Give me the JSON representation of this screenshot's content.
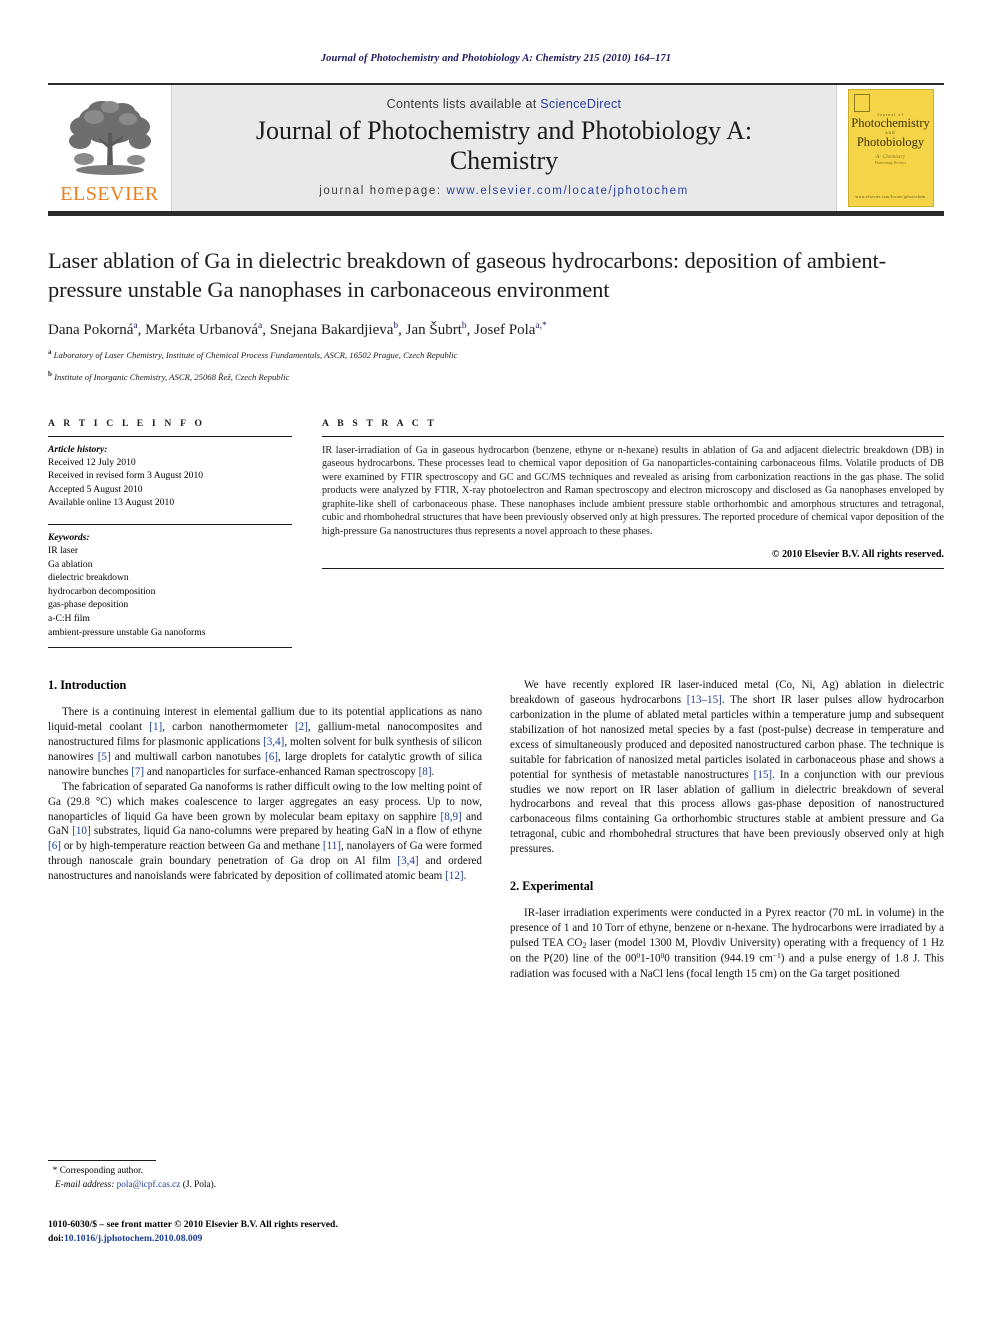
{
  "running_head": "Journal of Photochemistry and Photobiology A: Chemistry 215 (2010) 164–171",
  "masthead": {
    "publisher_logo_text": "ELSEVIER",
    "contents_prefix": "Contents lists available at ",
    "contents_link": "ScienceDirect",
    "journal_title_line1": "Journal of Photochemistry and Photobiology A:",
    "journal_title_line2": "Chemistry",
    "homepage_prefix": "journal homepage: ",
    "homepage_url": "www.elsevier.com/locate/jphotochem",
    "cover": {
      "kicker": "Journal of",
      "line1": "Photochemistry",
      "and": "and",
      "line2": "Photobiology",
      "sub": "A: Chemistry",
      "sub2": "Photoenergy Reviews",
      "footer": "www.elsevier.com/locate/jphotochem"
    }
  },
  "article": {
    "title": "Laser ablation of Ga in dielectric breakdown of gaseous hydrocarbons: deposition of ambient-pressure unstable Ga nanophases in carbonaceous environment",
    "authors_html": "Dana Pokorná<sup>a</sup>, Markéta Urbanová<sup>a</sup>, Snejana Bakardjieva<sup>b</sup>, Jan Šubrt<sup>b</sup>, Josef Pola<sup>a,</sup><sup>*</sup>",
    "affiliation_a": "Laboratory of Laser Chemistry, Institute of Chemical Process Fundamentals, ASCR, 16502 Prague, Czech Republic",
    "affiliation_b": "Institute of Inorganic Chemistry, ASCR, 25068 Řež, Czech Republic"
  },
  "info": {
    "heading": "A R T I C L E   I N F O",
    "history_label": "Article history:",
    "history": [
      "Received 12 July 2010",
      "Received in revised form 3 August 2010",
      "Accepted 5 August 2010",
      "Available online 13 August 2010"
    ],
    "keywords_label": "Keywords:",
    "keywords": [
      "IR laser",
      "Ga ablation",
      "dielectric breakdown",
      "hydrocarbon decomposition",
      "gas-phase deposition",
      "a-C:H film",
      "ambient-pressure unstable Ga nanoforms"
    ]
  },
  "abstract": {
    "heading": "A B S T R A C T",
    "text": "IR laser-irradiation of Ga in gaseous hydrocarbon (benzene, ethyne or n-hexane) results in ablation of Ga and adjacent dielectric breakdown (DB) in gaseous hydrocarbons. These processes lead to chemical vapor deposition of Ga nanoparticles-containing carbonaceous films. Volatile products of DB were examined by FTIR spectroscopy and GC and GC/MS techniques and revealed as arising from carbonization reactions in the gas phase. The solid products were analyzed by FTIR, X-ray photoelectron and Raman spectroscopy and electron microscopy and disclosed as Ga nanophases enveloped by graphite-like shell of carbonaceous phase. These nanophases include ambient pressure stable orthorhombic and amorphous structures and tetragonal, cubic and rhombohedral structures that have been previously observed only at high pressures. The reported procedure of chemical vapor deposition of the high-pressure Ga nanostructures thus represents a novel approach to these phases.",
    "copyright": "© 2010 Elsevier B.V. All rights reserved."
  },
  "sections": {
    "intro_heading": "1.  Introduction",
    "experimental_heading": "2.  Experimental",
    "intro_p1_a": "There is a continuing interest in elemental gallium due to its potential applications as nano liquid-metal coolant ",
    "intro_p1_r1": "[1]",
    "intro_p1_b": ", carbon nanothermometer ",
    "intro_p1_r2": "[2]",
    "intro_p1_c": ", gallium-metal nanocomposites and nanostructured films for plasmonic applications ",
    "intro_p1_r3": "[3,4]",
    "intro_p1_d": ", molten solvent for bulk synthesis of silicon nanowires ",
    "intro_p1_r4": "[5]",
    "intro_p1_e": " and multiwall carbon nanotubes ",
    "intro_p1_r5": "[6]",
    "intro_p1_f": ", large droplets for catalytic growth of silica nanowire bunches ",
    "intro_p1_r6": "[7]",
    "intro_p1_g": " and nanoparticles for surface-enhanced Raman spectroscopy ",
    "intro_p1_r7": "[8]",
    "intro_p1_h": ".",
    "intro_p2_a": "The fabrication of separated Ga nanoforms is rather difficult owing to the low melting point of Ga (29.8 °C) which makes coalescence to larger aggregates an easy process. Up to now, nanoparticles of liquid Ga have been grown by molecular beam epitaxy on sapphire ",
    "intro_p2_r1": "[8,9]",
    "intro_p2_b": " and GaN ",
    "intro_p2_r2": "[10]",
    "intro_p2_c": " substrates, liquid Ga nano-columns were prepared by heating GaN in a flow of ethyne ",
    "intro_p2_r3": "[6]",
    "intro_p2_d": " or by high-temperature reaction between Ga and methane ",
    "intro_p2_r4": "[11]",
    "intro_p2_e": ", nanolayers of Ga were formed through nanoscale grain boundary penetration of Ga drop on Al film ",
    "intro_p2_r5": "[3,4]",
    "intro_p2_f": " and ordered nanostructures and nanoislands were fabricated by deposition of collimated atomic beam ",
    "intro_p2_r6": "[12]",
    "intro_p2_g": ".",
    "intro_p3_a": "We have recently explored IR laser-induced metal (Co, Ni, Ag) ablation in dielectric breakdown of gaseous hydrocarbons ",
    "intro_p3_r1": "[13–15]",
    "intro_p3_b": ". The short IR laser pulses allow hydrocarbon carbonization in the plume of ablated metal particles within a temperature jump and subsequent stabilization of hot nanosized metal species by a fast (post-pulse) decrease in temperature and excess of simultaneously produced and deposited nanostructured carbon phase. The technique is suitable for fabrication of nanosized metal particles isolated in carbonaceous phase and shows a potential for synthesis of metastable nanostructures ",
    "intro_p3_r2": "[15]",
    "intro_p3_c": ". In a conjunction with our previous studies we now report on IR laser ablation of gallium in dielectric breakdown of several hydrocarbons and reveal that this process allows gas-phase deposition of nanostructured carbonaceous films containing Ga orthorhombic structures stable at ambient pressure and Ga tetragonal, cubic and rhombohedral structures that have been previously observed only at high pressures.",
    "exp_p1_a": "IR-laser irradiation experiments were conducted in a Pyrex reactor (70 mL in volume) in the presence of 1 and 10 Torr of ethyne, benzene or n-hexane. The hydrocarbons were irradiated by a pulsed TEA CO",
    "exp_p1_sub1": "2",
    "exp_p1_b": " laser (model 1300 M, Plovdiv University) operating with a frequency of 1 Hz on the P(20) line of the 00",
    "exp_p1_sup1": "0",
    "exp_p1_c": "1-10",
    "exp_p1_sup2": "0",
    "exp_p1_d": "0 transition (944.19 cm",
    "exp_p1_sup3": "−1",
    "exp_p1_e": ") and a pulse energy of 1.8 J. This radiation was focused with a NaCl lens (focal length 15 cm) on the Ga target positioned"
  },
  "footnote": {
    "star": "*",
    "corresponding": " Corresponding author.",
    "email_label": "E-mail address: ",
    "email": "pola@icpf.cas.cz",
    "email_suffix": " (J. Pola)."
  },
  "colophon": {
    "line1": "1010-6030/$ – see front matter © 2010 Elsevier B.V. All rights reserved.",
    "doi_label": "doi:",
    "doi": "10.1016/j.jphotochem.2010.08.009"
  },
  "colors": {
    "link_blue": "#1c3f94",
    "elsevier_orange": "#ef7d20",
    "banner_gray": "#e9e9e9",
    "rule_dark": "#2b2b2b",
    "cover_yellow": "#f5d547",
    "running_head_navy": "#1a1a5e"
  }
}
